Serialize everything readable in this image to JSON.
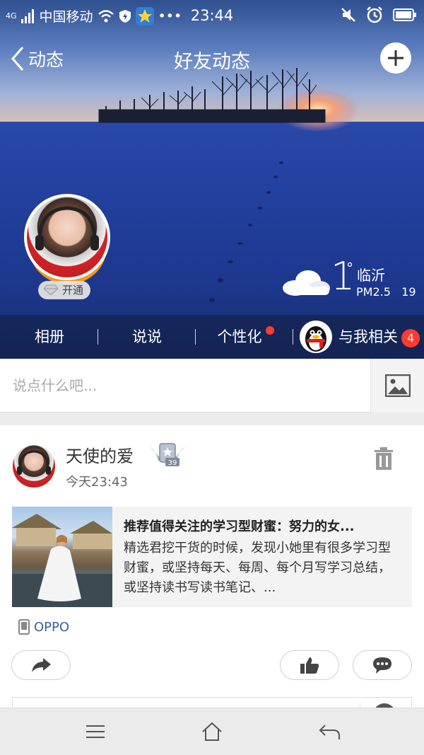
{
  "status_bar": {
    "network": "4G",
    "carrier": "中国移动",
    "time": "23:44",
    "more": "•••"
  },
  "nav": {
    "back_label": "动态",
    "title": "好友动态"
  },
  "profile": {
    "vip_label": "开通"
  },
  "weather": {
    "temperature": "1",
    "degree_symbol": "°",
    "city": "临沂",
    "pm_label": "PM2.5",
    "pm_value": "19"
  },
  "tabs": [
    {
      "label": "相册"
    },
    {
      "label": "说说"
    },
    {
      "label": "个性化"
    },
    {
      "label": "与我相关",
      "badge": "4"
    }
  ],
  "composer": {
    "placeholder": "说点什么吧..."
  },
  "post": {
    "author": "天使的爱",
    "level": "39",
    "time": "今天23:43",
    "share_title": "推荐值得关注的学习型财蜜：努力的女...",
    "share_desc": "精选君挖干货的时候，发现小她里有很多学习型财蜜，或坚持每天、每周、每个月写学习总结，或坚持读书写读书笔记、...",
    "device": "OPPO"
  },
  "colors": {
    "accent_red": "#ff3b30",
    "link_blue": "#3a5fa0",
    "ring_orange": "#f39a1e"
  }
}
